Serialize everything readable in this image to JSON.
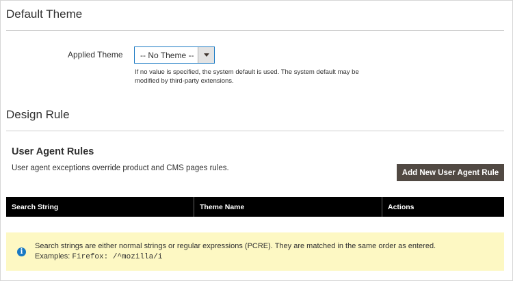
{
  "default_theme": {
    "title": "Default Theme",
    "applied_theme_label": "Applied Theme",
    "applied_theme_value": "-- No Theme --",
    "note": "If no value is specified, the system default is used. The system default may be modified by third-party extensions."
  },
  "design_rule": {
    "title": "Design Rule"
  },
  "user_agent_rules": {
    "title": "User Agent Rules",
    "description": "User agent exceptions override product and CMS pages rules.",
    "add_button": "Add New User Agent Rule",
    "columns": [
      "Search String",
      "Theme Name",
      "Actions"
    ],
    "message_line1": "Search strings are either normal strings or regular expressions (PCRE). They are matched in the same order as entered.",
    "message_prefix": "Examples: ",
    "message_example": "Firefox: /^mozilla/i"
  },
  "colors": {
    "button_bg": "#514943",
    "header_bg": "#000000",
    "message_bg": "#fdf8c3",
    "info_icon": "#1979c3",
    "select_border": "#1979c3"
  },
  "icons": {
    "info": "info-icon",
    "dropdown": "chevron-down-icon"
  }
}
